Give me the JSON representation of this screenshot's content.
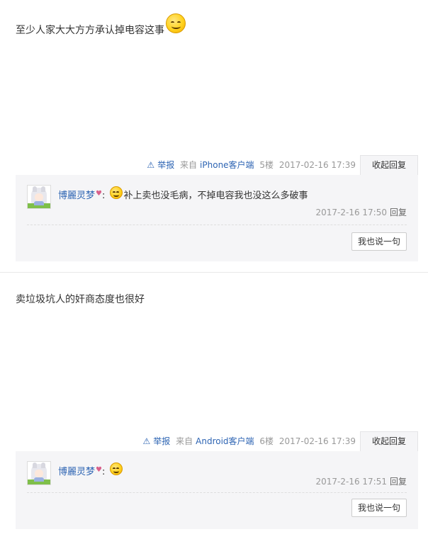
{
  "posts": [
    {
      "content": "至少人家大大方方承认掉电容这事",
      "content_emoji": "smiley-face",
      "report_label": "举报",
      "client_prefix": "来自",
      "client_name": "iPhone客户端",
      "floor": "5楼",
      "timestamp": "2017-02-16 17:39",
      "toggle_label": "收起回复",
      "replies": [
        {
          "user": "博麗灵梦",
          "text": "补上卖也没毛病，不掉电容我也没这么多破事",
          "emoji": "smiley-face",
          "timestamp": "2017-2-16 17:50",
          "reply_label": "回复"
        }
      ],
      "say_button": "我也说一句"
    },
    {
      "content": "卖垃圾坑人的奸商态度也很好",
      "report_label": "举报",
      "client_prefix": "来自",
      "client_name": "Android客户端",
      "floor": "6楼",
      "timestamp": "2017-02-16 17:39",
      "toggle_label": "收起回复",
      "replies": [
        {
          "user": "博麗灵梦",
          "text": "",
          "emoji": "smiley-face",
          "timestamp": "2017-2-16 17:51",
          "reply_label": "回复"
        }
      ],
      "say_button": "我也说一句"
    }
  ],
  "colors": {
    "link": "#2d64b3",
    "meta": "#999999",
    "reply_bg": "#f5f5f7",
    "heart": "#d9608a"
  },
  "icons": {
    "report": "warning-triangle-icon",
    "emoji": "smiley-icon",
    "heart": "heart-icon"
  }
}
